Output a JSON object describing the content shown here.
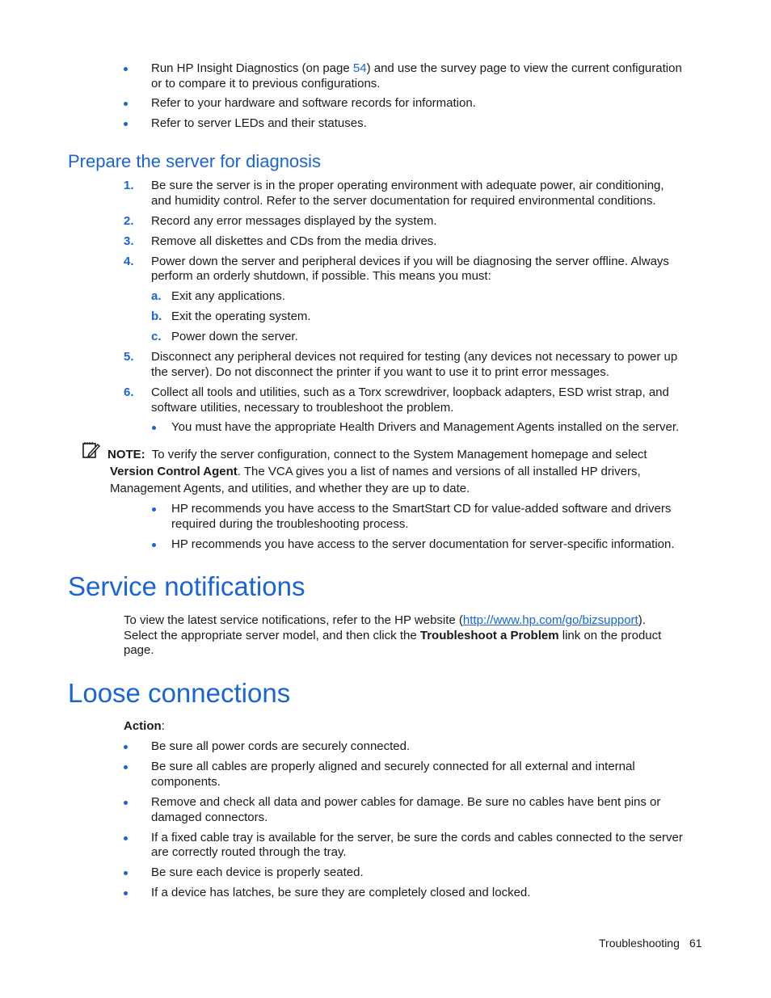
{
  "intro_bullets": [
    {
      "pre": "Run HP Insight Diagnostics (on page ",
      "link": "54",
      "post": ") and use the survey page to view the current configuration",
      "line2": "or to compare it to previous configurations."
    },
    {
      "text": "Refer to your hardware and software records for information."
    },
    {
      "text": "Refer to server LEDs and their statuses."
    }
  ],
  "prepare": {
    "heading": "Prepare the server for diagnosis",
    "steps": [
      {
        "num": "1.",
        "line1": "Be sure the server is in the proper operating environment with adequate power, air conditioning,",
        "line2": "and humidity control. Refer to the server documentation for required environmental conditions."
      },
      {
        "num": "2.",
        "line1": "Record any error messages displayed by the system."
      },
      {
        "num": "3.",
        "line1": "Remove all diskettes and CDs from the media drives."
      },
      {
        "num": "4.",
        "line1": "Power down the server and peripheral devices if you will be diagnosing the server offline. Always",
        "line2": "perform an orderly shutdown, if possible. This means you must:"
      },
      {
        "num": "5.",
        "line1": "Disconnect any peripheral devices not required for testing (any devices not necessary to power up",
        "line2": "the server). Do not disconnect the printer if you want to use it to print error messages."
      },
      {
        "num": "6.",
        "line1": "Collect all tools and utilities, such as a Torx screwdriver, loopback adapters, ESD wrist strap, and",
        "line2": "software utilities, necessary to troubleshoot the problem."
      }
    ],
    "substeps": [
      {
        "letter": "a.",
        "text": "Exit any applications."
      },
      {
        "letter": "b.",
        "text": "Exit the operating system."
      },
      {
        "letter": "c.",
        "text": "Power down the server."
      }
    ],
    "step6_bullet": "You must have the appropriate Health Drivers and Management Agents installed on the server.",
    "note": {
      "label": "NOTE:",
      "line1": "To verify the server configuration, connect to the System Management homepage and select",
      "bold": "Version Control Agent",
      "line2_rest": ". The VCA gives you a list of names and versions of all installed HP drivers,",
      "line3": "Management Agents, and utilities, and whether they are up to date."
    },
    "after_note_bullets": [
      {
        "line1": "HP recommends you have access to the SmartStart CD for value-added software and drivers",
        "line2": "required during the troubleshooting process."
      },
      {
        "line1": "HP recommends you have access to the server documentation for server-specific information."
      }
    ]
  },
  "service": {
    "heading": "Service notifications",
    "pre": "To view the latest service notifications, refer to the HP website (",
    "link": "http://www.hp.com/go/bizsupport",
    "post": ").",
    "line2_pre": "Select the appropriate server model, and then click the ",
    "line2_bold": "Troubleshoot a Problem",
    "line2_post": " link on the product",
    "line3": "page."
  },
  "loose": {
    "heading": "Loose connections",
    "action_label": "Action",
    "action_colon": ":",
    "bullets": [
      {
        "line1": "Be sure all power cords are securely connected."
      },
      {
        "line1": "Be sure all cables are properly aligned and securely connected for all external and internal",
        "line2": "components."
      },
      {
        "line1": "Remove and check all data and power cables for damage. Be sure no cables have bent pins or",
        "line2": "damaged connectors."
      },
      {
        "line1": "If a fixed cable tray is available for the server, be sure the cords and cables connected to the server",
        "line2": "are correctly routed through the tray."
      },
      {
        "line1": "Be sure each device is properly seated."
      },
      {
        "line1": "If a device has latches, be sure they are completely closed and locked."
      }
    ]
  },
  "footer": {
    "section": "Troubleshooting",
    "page": "61"
  }
}
